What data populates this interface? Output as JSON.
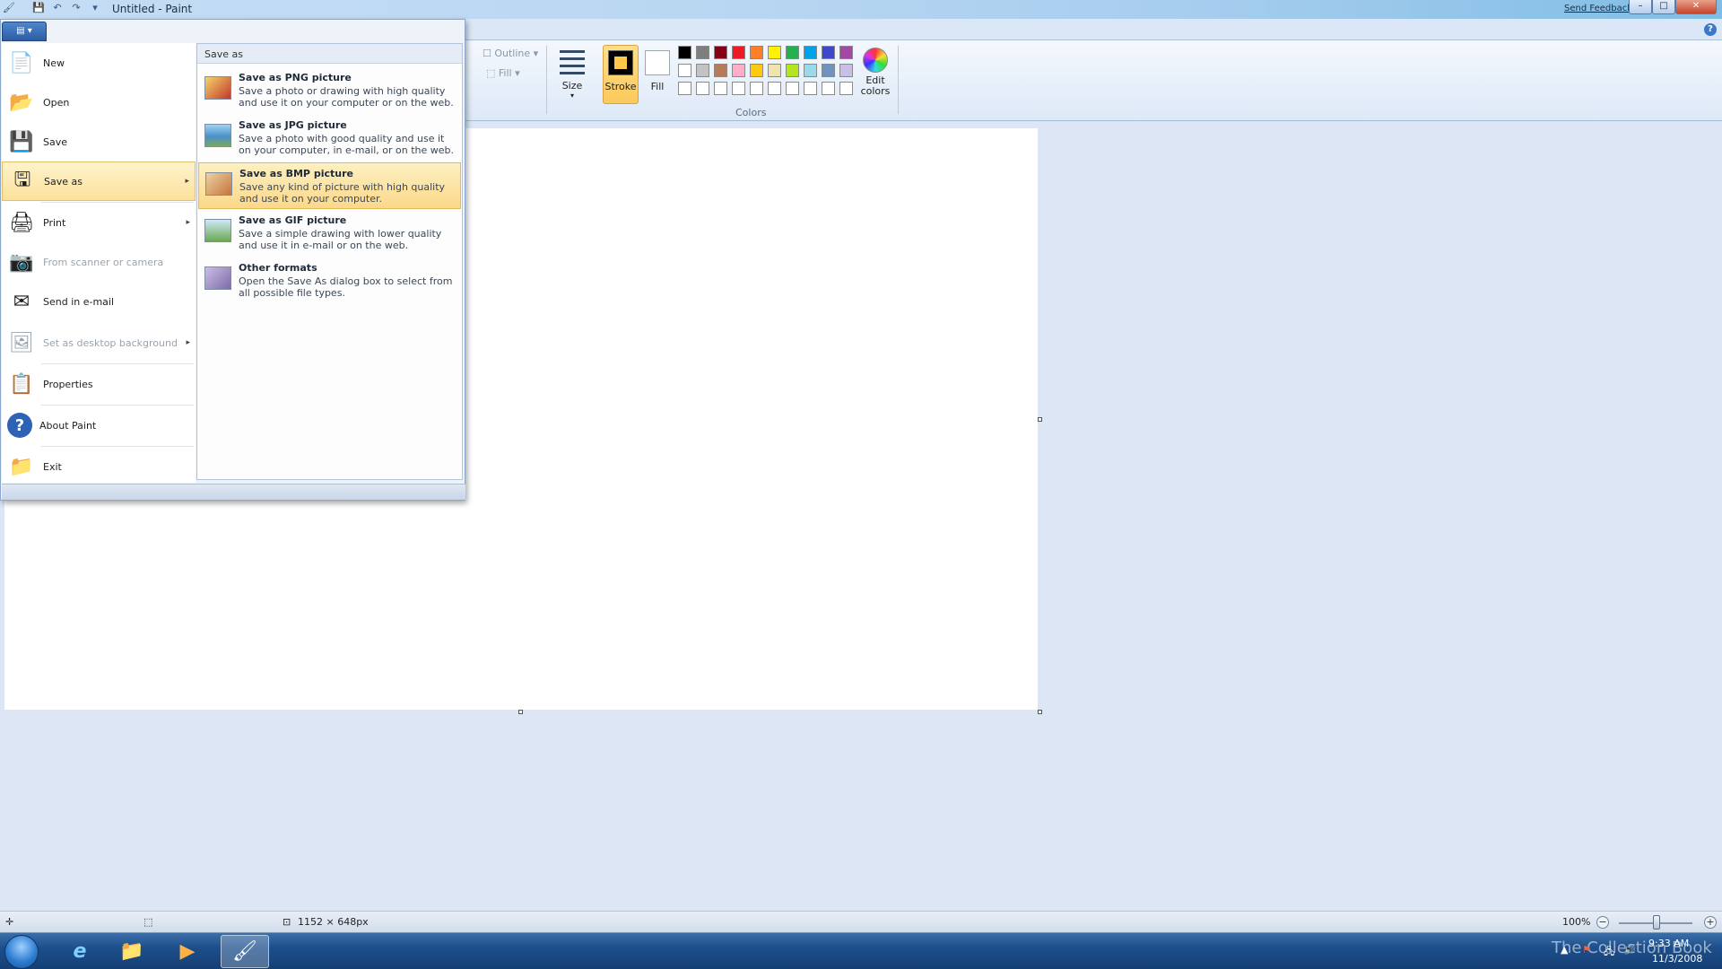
{
  "window": {
    "title": "Untitled - Paint",
    "send_feedback": "Send Feedback",
    "minimize": "–",
    "maximize": "□",
    "close": "✕"
  },
  "quick_access": {
    "save_icon": "💾",
    "undo_icon": "↶",
    "redo_icon": "↷",
    "customize_icon": "▾"
  },
  "ribbon": {
    "app_button": "▤ ▾",
    "help": "?",
    "outline_label": "Outline",
    "fill_shape_label": "Fill",
    "size_label": "Size",
    "stroke_label": "Stroke",
    "fill_label": "Fill",
    "edit_colors_label": "Edit colors",
    "colors_group_label": "Colors",
    "palette": [
      "#000000",
      "#7f7f7f",
      "#880015",
      "#ed1c24",
      "#ff7f27",
      "#fff200",
      "#22b14c",
      "#00a2e8",
      "#3f48cc",
      "#a349a4",
      "#ffffff",
      "#c3c3c3",
      "#b97a57",
      "#ffaec9",
      "#ffc90e",
      "#efe4b0",
      "#b5e61d",
      "#99d9ea",
      "#7092be",
      "#c8bfe7",
      "#ffffff",
      "#ffffff",
      "#ffffff",
      "#ffffff",
      "#ffffff",
      "#ffffff",
      "#ffffff",
      "#ffffff",
      "#ffffff",
      "#ffffff"
    ]
  },
  "app_menu": {
    "tab_label": "▤ ▾",
    "items": [
      {
        "label": "New",
        "icon": "📄"
      },
      {
        "label": "Open",
        "icon": "📂"
      },
      {
        "label": "Save",
        "icon": "💾"
      },
      {
        "label": "Save as",
        "icon": "🖫"
      },
      {
        "label": "Print",
        "icon": "🖨"
      },
      {
        "label": "From scanner or camera",
        "icon": "📷"
      },
      {
        "label": "Send in e-mail",
        "icon": "✉"
      },
      {
        "label": "Set as desktop background",
        "icon": "🖼"
      },
      {
        "label": "Properties",
        "icon": "📋"
      },
      {
        "label": "About Paint",
        "icon": "?"
      },
      {
        "label": "Exit",
        "icon": "📁"
      }
    ],
    "arrow": "▸"
  },
  "save_as_menu": {
    "header": "Save as",
    "items": [
      {
        "title": "Save as PNG picture",
        "desc": "Save a photo or drawing with high quality and use it on your computer or on the web.",
        "color": "#c0392b"
      },
      {
        "title": "Save as JPG picture",
        "desc": "Save a photo with good quality and use it on your computer, in e-mail, or on the web.",
        "color": "#4a90c8"
      },
      {
        "title": "Save as BMP picture",
        "desc": "Save any kind of picture with high quality and use it on your computer.",
        "color": "#c8743a"
      },
      {
        "title": "Save as GIF picture",
        "desc": "Save a simple drawing with lower quality and use it in e-mail or on the web.",
        "color": "#6aa84f"
      },
      {
        "title": "Other formats",
        "desc": "Open the Save As dialog box to select from all possible file types.",
        "color": "#7d6aa8"
      }
    ]
  },
  "statusbar": {
    "dimensions": "1152 × 648px",
    "zoom": "100%",
    "zoom_out": "−",
    "zoom_in": "+",
    "move_icon": "✛",
    "select_icon": "⬚",
    "size_icon": "⊡"
  },
  "taskbar": {
    "ie_icon": "e",
    "explorer_icon": "📁",
    "media_icon": "▶",
    "paint_icon": "🖌",
    "watermark": "The Collection Book",
    "time": "9:33 AM",
    "date": "11/3/2008",
    "tray_flag": "⚑",
    "tray_net": "🖧",
    "tray_vol": "🔊",
    "tray_up": "▲"
  }
}
